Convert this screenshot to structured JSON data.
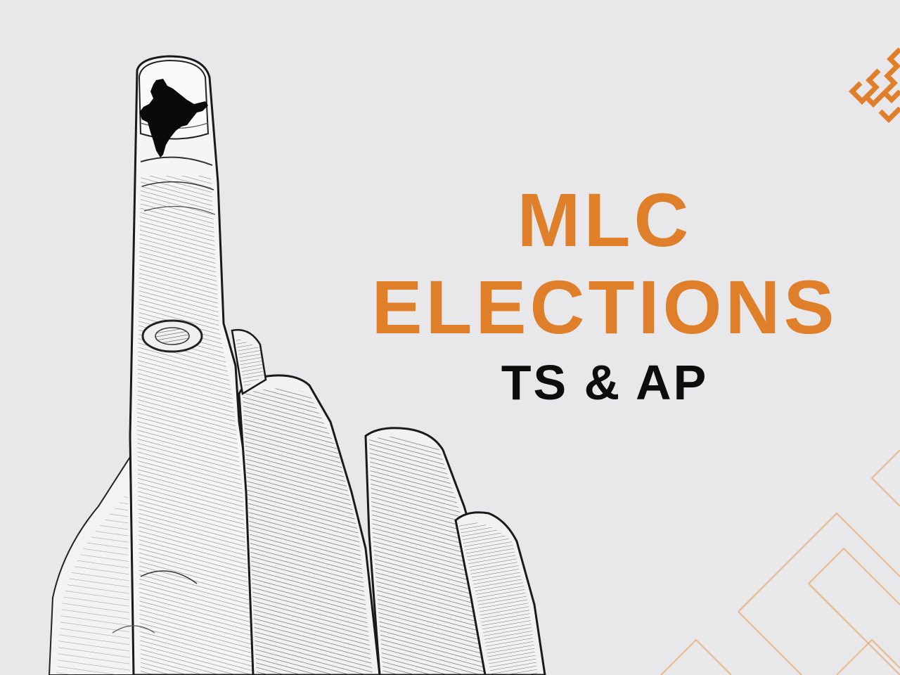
{
  "headline": {
    "line1": "MLC",
    "line2": "ELECTIONS",
    "line3": "TS & AP"
  },
  "illustration": {
    "subject": "hand-with-inked-finger",
    "ink_mark_icon": "india-map-icon"
  },
  "logo": {
    "icon": "endless-knot-icon",
    "color": "#e07f2a"
  },
  "colors": {
    "background": "#e8e8ea",
    "accent": "#e07f2a",
    "text_dark": "#0d0d0d"
  }
}
